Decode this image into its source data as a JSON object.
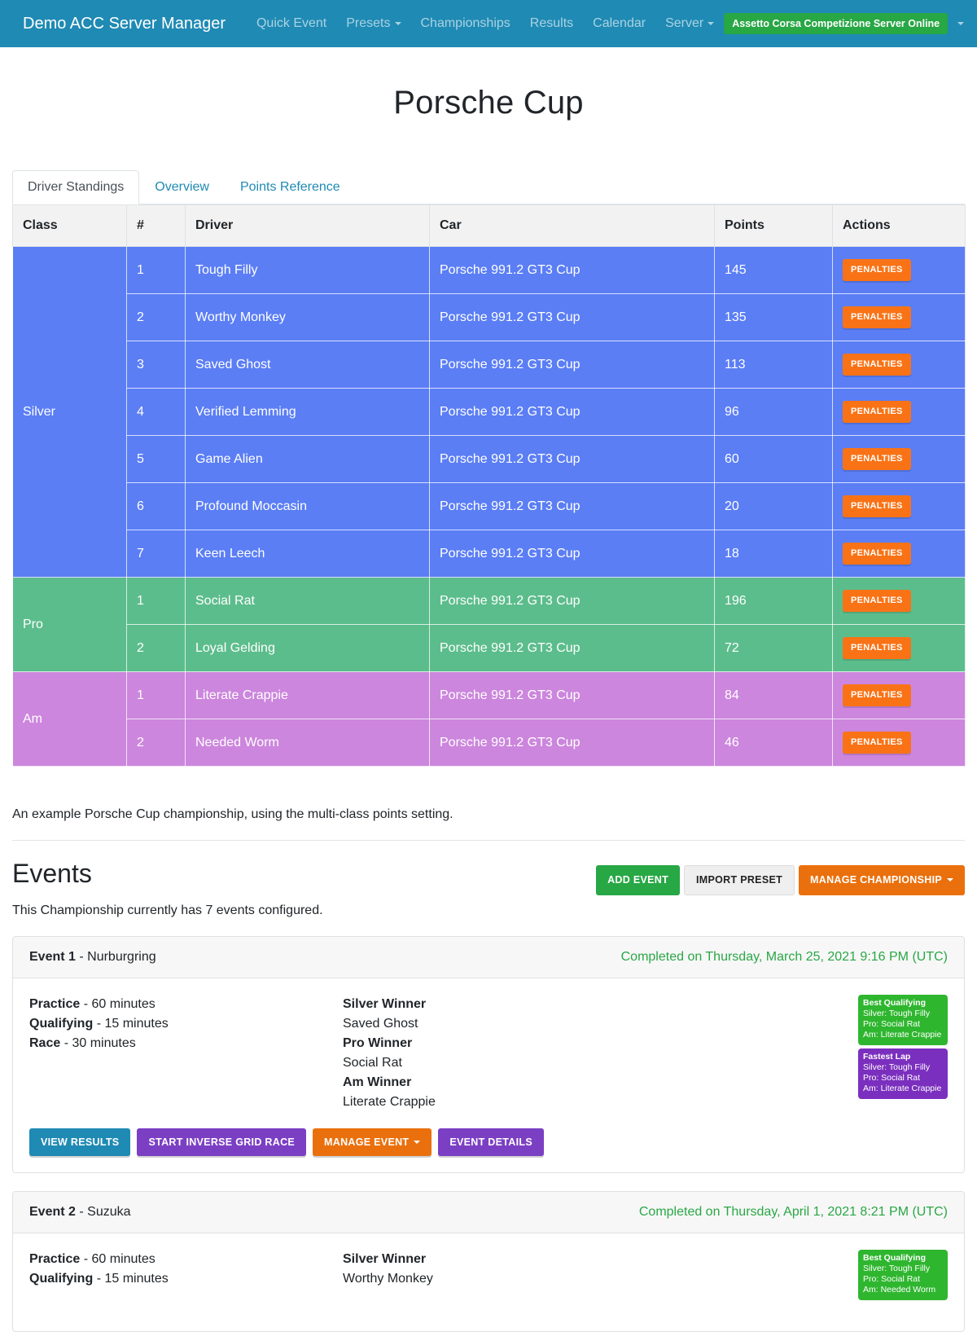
{
  "navbar": {
    "brand": "Demo ACC Server Manager",
    "links": [
      {
        "label": "Quick Event",
        "caret": false
      },
      {
        "label": "Presets",
        "caret": true
      },
      {
        "label": "Championships",
        "caret": false
      },
      {
        "label": "Results",
        "caret": false
      },
      {
        "label": "Calendar",
        "caret": false
      },
      {
        "label": "Server",
        "caret": true
      }
    ],
    "status_badge": "Assetto Corsa Competizione Server Online",
    "status_color": "#28a745",
    "user_icon": "user-icon"
  },
  "page": {
    "title": "Porsche Cup",
    "description": "An example Porsche Cup championship, using the multi-class points setting."
  },
  "tabs": [
    {
      "label": "Driver Standings",
      "active": true
    },
    {
      "label": "Overview",
      "active": false
    },
    {
      "label": "Points Reference",
      "active": false
    }
  ],
  "standings": {
    "columns": [
      "Class",
      "#",
      "Driver",
      "Car",
      "Points",
      "Actions"
    ],
    "action_label": "PENALTIES",
    "class_colors": {
      "Silver": "#5b7ef5",
      "Pro": "#5cbd8c",
      "Am": "#cc86dd"
    },
    "groups": [
      {
        "class": "Silver",
        "rows": [
          {
            "num": "1",
            "driver": "Tough Filly",
            "car": "Porsche 991.2 GT3 Cup",
            "points": "145"
          },
          {
            "num": "2",
            "driver": "Worthy Monkey",
            "car": "Porsche 991.2 GT3 Cup",
            "points": "135"
          },
          {
            "num": "3",
            "driver": "Saved Ghost",
            "car": "Porsche 991.2 GT3 Cup",
            "points": "113"
          },
          {
            "num": "4",
            "driver": "Verified Lemming",
            "car": "Porsche 991.2 GT3 Cup",
            "points": "96"
          },
          {
            "num": "5",
            "driver": "Game Alien",
            "car": "Porsche 991.2 GT3 Cup",
            "points": "60"
          },
          {
            "num": "6",
            "driver": "Profound Moccasin",
            "car": "Porsche 991.2 GT3 Cup",
            "points": "20"
          },
          {
            "num": "7",
            "driver": "Keen Leech",
            "car": "Porsche 991.2 GT3 Cup",
            "points": "18"
          }
        ]
      },
      {
        "class": "Pro",
        "rows": [
          {
            "num": "1",
            "driver": "Social Rat",
            "car": "Porsche 991.2 GT3 Cup",
            "points": "196"
          },
          {
            "num": "2",
            "driver": "Loyal Gelding",
            "car": "Porsche 991.2 GT3 Cup",
            "points": "72"
          }
        ]
      },
      {
        "class": "Am",
        "rows": [
          {
            "num": "1",
            "driver": "Literate Crappie",
            "car": "Porsche 991.2 GT3 Cup",
            "points": "84"
          },
          {
            "num": "2",
            "driver": "Needed Worm",
            "car": "Porsche 991.2 GT3 Cup",
            "points": "46"
          }
        ]
      }
    ]
  },
  "events": {
    "title": "Events",
    "subtitle": "This Championship currently has 7 events configured.",
    "buttons": {
      "add_event": "ADD EVENT",
      "import_preset": "IMPORT PRESET",
      "manage_championship": "MANAGE CHAMPIONSHIP"
    },
    "list": [
      {
        "number": "Event 1",
        "track": "- Nurburgring",
        "completed": "Completed on Thursday, March 25, 2021 9:16 PM (UTC)",
        "sessions": [
          {
            "name": "Practice",
            "detail": "- 60 minutes"
          },
          {
            "name": "Qualifying",
            "detail": "- 15 minutes"
          },
          {
            "name": "Race",
            "detail": "- 30 minutes"
          }
        ],
        "winners": [
          {
            "label": "Silver Winner",
            "name": "Saved Ghost"
          },
          {
            "label": "Pro Winner",
            "name": "Social Rat"
          },
          {
            "label": "Am Winner",
            "name": "Literate Crappie"
          }
        ],
        "awards": [
          {
            "title": "Best Qualifying",
            "color": "#2fb62f",
            "lines": [
              "Silver: Tough Filly",
              "Pro: Social Rat",
              "Am: Literate Crappie"
            ]
          },
          {
            "title": "Fastest Lap",
            "color": "#7b2fbe",
            "lines": [
              "Silver: Tough Filly",
              "Pro: Social Rat",
              "Am: Literate Crappie"
            ]
          }
        ],
        "actions": [
          {
            "label": "VIEW RESULTS",
            "style": "teal",
            "caret": false
          },
          {
            "label": "START INVERSE GRID RACE",
            "style": "purple",
            "caret": false
          },
          {
            "label": "MANAGE EVENT",
            "style": "orange",
            "caret": true
          },
          {
            "label": "EVENT DETAILS",
            "style": "purple",
            "caret": false
          }
        ]
      },
      {
        "number": "Event 2",
        "track": "- Suzuka",
        "completed": "Completed on Thursday, April 1, 2021 8:21 PM (UTC)",
        "sessions": [
          {
            "name": "Practice",
            "detail": "- 60 minutes"
          },
          {
            "name": "Qualifying",
            "detail": "- 15 minutes"
          }
        ],
        "winners": [
          {
            "label": "Silver Winner",
            "name": "Worthy Monkey"
          }
        ],
        "awards": [
          {
            "title": "Best Qualifying",
            "color": "#2fb62f",
            "lines": [
              "Silver: Tough Filly",
              "Pro: Social Rat",
              "Am: Needed Worm"
            ]
          }
        ],
        "actions": []
      }
    ]
  }
}
